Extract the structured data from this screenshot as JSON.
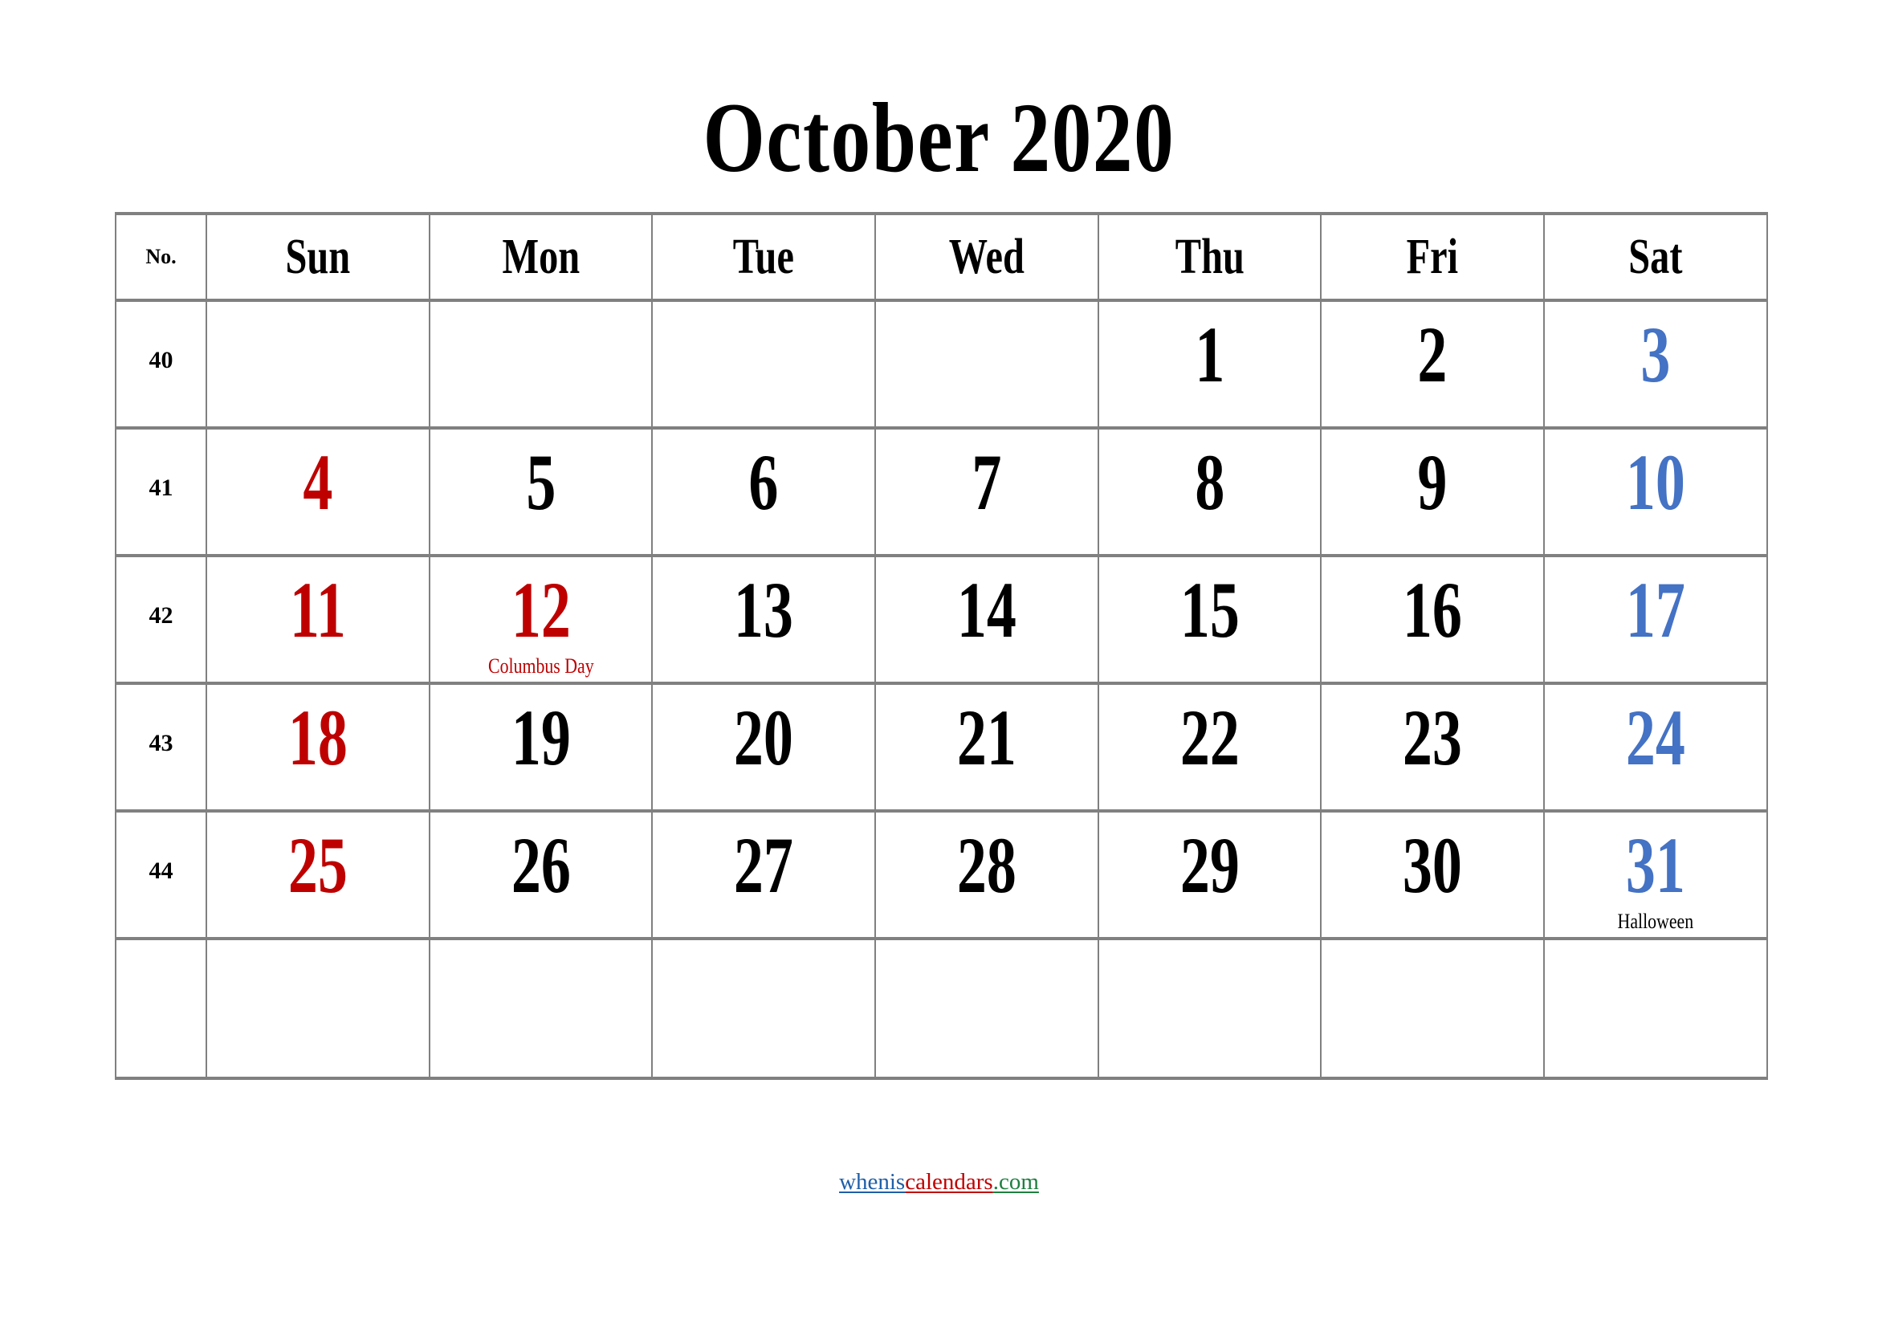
{
  "title": "October 2020",
  "month": "October",
  "year": "2020",
  "week_number_header": "No.",
  "day_headers": [
    "Sun",
    "Mon",
    "Tue",
    "Wed",
    "Thu",
    "Fri",
    "Sat"
  ],
  "colors": {
    "sunday": "#BE0000",
    "saturday": "#4472C4",
    "weekday": "#000000",
    "grid": "#808080",
    "background": "#FFFFFF",
    "footer_blue": "#1F5FA8",
    "footer_red": "#C00000",
    "footer_green": "#1E8040"
  },
  "weeks": [
    {
      "number": "40",
      "days": [
        {
          "date": "",
          "holiday": "",
          "kind": "empty"
        },
        {
          "date": "",
          "holiday": "",
          "kind": "empty"
        },
        {
          "date": "",
          "holiday": "",
          "kind": "empty"
        },
        {
          "date": "",
          "holiday": "",
          "kind": "empty"
        },
        {
          "date": "1",
          "holiday": "",
          "kind": "weekday"
        },
        {
          "date": "2",
          "holiday": "",
          "kind": "weekday"
        },
        {
          "date": "3",
          "holiday": "",
          "kind": "sat"
        }
      ]
    },
    {
      "number": "41",
      "days": [
        {
          "date": "4",
          "holiday": "",
          "kind": "sun"
        },
        {
          "date": "5",
          "holiday": "",
          "kind": "weekday"
        },
        {
          "date": "6",
          "holiday": "",
          "kind": "weekday"
        },
        {
          "date": "7",
          "holiday": "",
          "kind": "weekday"
        },
        {
          "date": "8",
          "holiday": "",
          "kind": "weekday"
        },
        {
          "date": "9",
          "holiday": "",
          "kind": "weekday"
        },
        {
          "date": "10",
          "holiday": "",
          "kind": "sat"
        }
      ]
    },
    {
      "number": "42",
      "days": [
        {
          "date": "11",
          "holiday": "",
          "kind": "sun"
        },
        {
          "date": "12",
          "holiday": "Columbus Day",
          "holiday_color": "red",
          "kind": "sun"
        },
        {
          "date": "13",
          "holiday": "",
          "kind": "weekday"
        },
        {
          "date": "14",
          "holiday": "",
          "kind": "weekday"
        },
        {
          "date": "15",
          "holiday": "",
          "kind": "weekday"
        },
        {
          "date": "16",
          "holiday": "",
          "kind": "weekday"
        },
        {
          "date": "17",
          "holiday": "",
          "kind": "sat"
        }
      ]
    },
    {
      "number": "43",
      "days": [
        {
          "date": "18",
          "holiday": "",
          "kind": "sun"
        },
        {
          "date": "19",
          "holiday": "",
          "kind": "weekday"
        },
        {
          "date": "20",
          "holiday": "",
          "kind": "weekday"
        },
        {
          "date": "21",
          "holiday": "",
          "kind": "weekday"
        },
        {
          "date": "22",
          "holiday": "",
          "kind": "weekday"
        },
        {
          "date": "23",
          "holiday": "",
          "kind": "weekday"
        },
        {
          "date": "24",
          "holiday": "",
          "kind": "sat"
        }
      ]
    },
    {
      "number": "44",
      "days": [
        {
          "date": "25",
          "holiday": "",
          "kind": "sun"
        },
        {
          "date": "26",
          "holiday": "",
          "kind": "weekday"
        },
        {
          "date": "27",
          "holiday": "",
          "kind": "weekday"
        },
        {
          "date": "28",
          "holiday": "",
          "kind": "weekday"
        },
        {
          "date": "29",
          "holiday": "",
          "kind": "weekday"
        },
        {
          "date": "30",
          "holiday": "",
          "kind": "weekday"
        },
        {
          "date": "31",
          "holiday": "Halloween",
          "holiday_color": "black",
          "kind": "sat"
        }
      ]
    },
    {
      "number": "",
      "days": [
        {
          "date": "",
          "holiday": "",
          "kind": "empty"
        },
        {
          "date": "",
          "holiday": "",
          "kind": "empty"
        },
        {
          "date": "",
          "holiday": "",
          "kind": "empty"
        },
        {
          "date": "",
          "holiday": "",
          "kind": "empty"
        },
        {
          "date": "",
          "holiday": "",
          "kind": "empty"
        },
        {
          "date": "",
          "holiday": "",
          "kind": "empty"
        },
        {
          "date": "",
          "holiday": "",
          "kind": "empty"
        }
      ]
    }
  ],
  "footer": {
    "full": "wheniscalendars.com",
    "part1": "whenis",
    "part2": "calendars",
    "part3": ".com"
  }
}
